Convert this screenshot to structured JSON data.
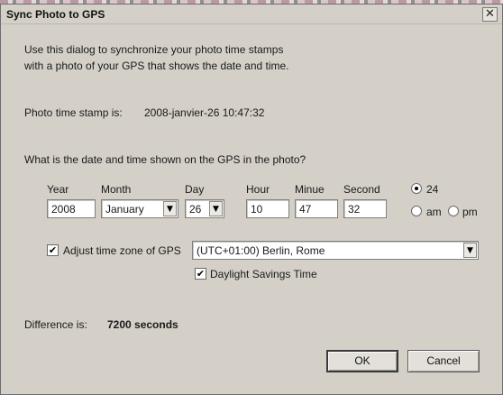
{
  "window": {
    "title": "Sync Photo to GPS",
    "close_glyph": "✕"
  },
  "intro": {
    "line1": "Use this dialog to synchronize your photo time stamps",
    "line2": "with a photo of your GPS that shows the date and time."
  },
  "timestamp": {
    "label": "Photo time stamp is:",
    "value": "2008-janvier-26  10:47:32"
  },
  "question": "What is the date and time shown on the GPS in the photo?",
  "fields": {
    "year": {
      "label": "Year",
      "value": "2008"
    },
    "month": {
      "label": "Month",
      "value": "January"
    },
    "day": {
      "label": "Day",
      "value": "26"
    },
    "hour": {
      "label": "Hour",
      "value": "10"
    },
    "minute": {
      "label": "Minue",
      "value": "47"
    },
    "second": {
      "label": "Second",
      "value": "32"
    }
  },
  "clock": {
    "h24_label": "24",
    "am_label": "am",
    "pm_label": "pm",
    "selected": "24"
  },
  "timezone": {
    "checkbox_label": "Adjust time zone of GPS",
    "checked": true,
    "value": "(UTC+01:00)  Berlin, Rome"
  },
  "dst": {
    "label": "Daylight Savings Time",
    "checked": true
  },
  "difference": {
    "label": "Difference is:",
    "value": "7200 seconds"
  },
  "buttons": {
    "ok": "OK",
    "cancel": "Cancel"
  },
  "icons": {
    "dropdown": "▼",
    "check": "✔"
  }
}
